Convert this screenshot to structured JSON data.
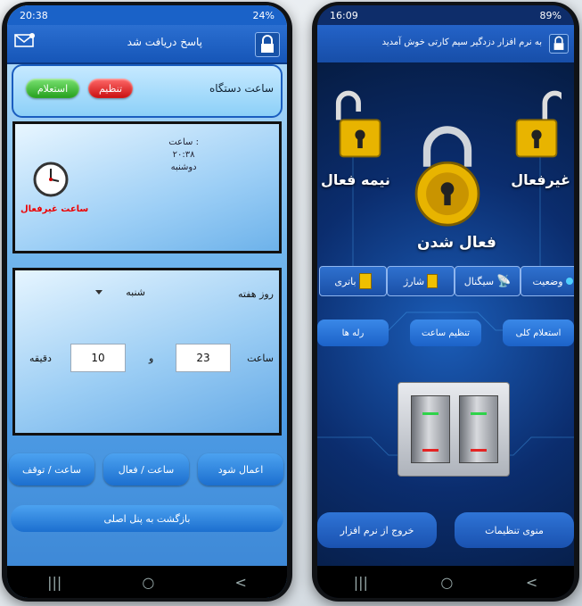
{
  "left_phone": {
    "status_time": "20:38",
    "status_battery": "24%",
    "header_title": "پاسخ دریافت شد",
    "device_clock_label": "ساعت دستگاه",
    "set_label": "تنظیم",
    "query_label": "استعلام",
    "clock_title": "ساعت :",
    "clock_time": "۲۰:۳۸",
    "clock_day": "دوشنبه",
    "clock_status": "ساعت غیرفعال",
    "weekday_label": "روز هفته",
    "weekday_value": "شنبه",
    "time_label": "ساعت",
    "hour_value": "23",
    "and_label": "و",
    "minute_value": "10",
    "minute_label": "دقیقه",
    "apply_label": "اعمال شود",
    "clock_on_label": "ساعت / فعال",
    "clock_off_label": "ساعت / توقف",
    "back_label": "بازگشت به پنل اصلی",
    "nav_recent": "|||",
    "nav_home": "○",
    "nav_back": "<"
  },
  "right_phone": {
    "status_time": "16:09",
    "status_battery": "89%",
    "header_title": "به نرم افزار دزدگیر سیم کارتی خوش آمدید",
    "lock_off_label": "غیرفعال",
    "lock_half_label": "نیمه فعال",
    "lock_on_label": "فعال شدن",
    "tab_status": "وضعیت",
    "tab_signal": "سیگنال",
    "tab_charge": "شارژ",
    "tab_battery": "باتری",
    "query_all_label": "استعلام کلی",
    "set_clock_label": "تنظیم ساعت",
    "relays_label": "رله ها",
    "settings_menu_label": "منوی تنظیمات",
    "exit_label": "خروج از نرم افزار",
    "nav_recent": "|||",
    "nav_home": "○",
    "nav_back": "<"
  },
  "colors": {
    "left_header": "#1a62c8",
    "right_bg": "#0b2d6e",
    "lock_gold": "#e8b400",
    "set_red": "#d51a1a",
    "query_green": "#2eaa25"
  }
}
